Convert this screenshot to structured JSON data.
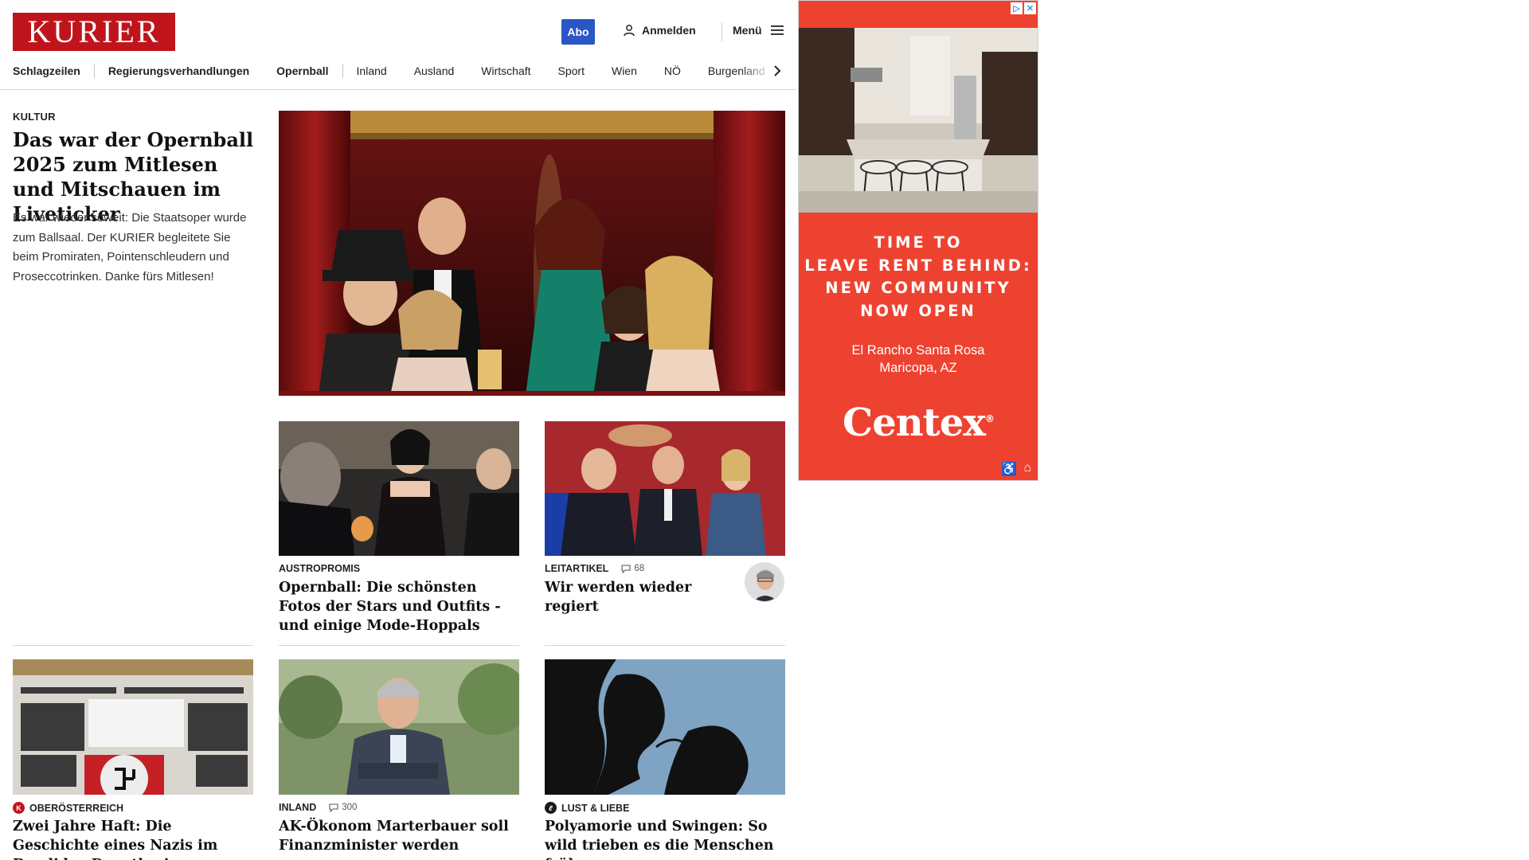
{
  "brand": {
    "logo_text": "KURIER",
    "color": "#c0141c"
  },
  "header": {
    "abo_label": "Abo",
    "login_label": "Anmelden",
    "menu_label": "Menü"
  },
  "nav": {
    "items": [
      "Schlagzeilen",
      "Regierungsverhandlungen",
      "Opernball",
      "Inland",
      "Ausland",
      "Wirtschaft",
      "Sport",
      "Wien",
      "NÖ",
      "Burgenland"
    ]
  },
  "lead": {
    "kicker": "KULTUR",
    "title": "Das war der Opernball 2025 zum Mitlesen und Mitschauen im Liveticker",
    "teaser": "Es war wieder soweit: Die Staatsoper wurde zum Ballsaal. Der KURIER begleitete Sie beim Promiraten, Pointenschleudern und Proseccotrinken. Danke fürs Mitlesen!"
  },
  "articles": [
    {
      "kicker": "AUSTROPROMIS",
      "title": "Opernball: Die schönsten Fotos der Stars und Outfits - und einige Mode-Hoppals"
    },
    {
      "kicker": "LEITARTIKEL",
      "comments": "68",
      "title": "Wir werden wieder regiert"
    },
    {
      "kicker": "OBERÖSTERREICH",
      "title": "Zwei Jahre Haft: Die Geschichte eines Nazis im Bandidos-Dunstkreis"
    },
    {
      "kicker": "INLAND",
      "comments": "300",
      "title": "AK-Ökonom Marterbauer soll Finanzminister werden"
    },
    {
      "kicker": "LUST & LIEBE",
      "title": "Polyamorie und Swingen: So wild trieben es die Menschen früher"
    }
  ],
  "ad": {
    "headline": [
      "TIME TO",
      "LEAVE RENT BEHIND:",
      "NEW COMMUNITY",
      "NOW OPEN"
    ],
    "location": [
      "El Rancho Santa Rosa",
      "Maricopa, AZ"
    ],
    "brand": "Centex",
    "registered_mark": "®",
    "background_color": "#ee4231"
  }
}
